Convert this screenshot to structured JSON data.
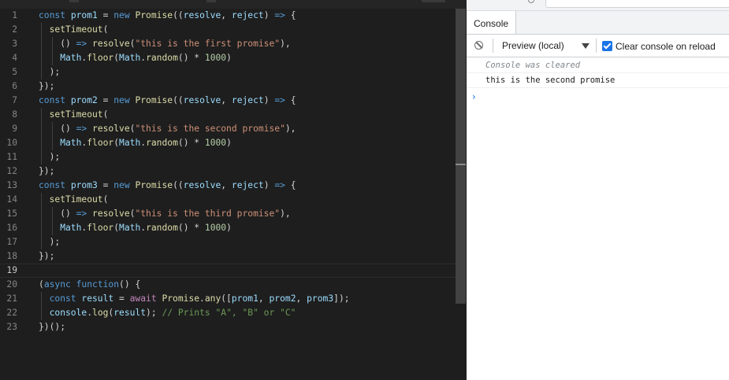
{
  "editor": {
    "lines": [
      {
        "n": "1",
        "indent": 0,
        "tokens": [
          [
            "kw",
            "const "
          ],
          [
            "var",
            "prom1"
          ],
          [
            "pun",
            " = "
          ],
          [
            "kw",
            "new "
          ],
          [
            "fn",
            "Promise"
          ],
          [
            "pun",
            "(("
          ],
          [
            "var",
            "resolve"
          ],
          [
            "pun",
            ", "
          ],
          [
            "var",
            "reject"
          ],
          [
            "pun",
            ") "
          ],
          [
            "kw",
            "=>"
          ],
          [
            "pun",
            " {"
          ]
        ]
      },
      {
        "n": "2",
        "indent": 1,
        "tokens": [
          [
            "fn",
            "setTimeout"
          ],
          [
            "pun",
            "("
          ]
        ]
      },
      {
        "n": "3",
        "indent": 2,
        "tokens": [
          [
            "pun",
            "() "
          ],
          [
            "kw",
            "=>"
          ],
          [
            "pun",
            " "
          ],
          [
            "fn",
            "resolve"
          ],
          [
            "pun",
            "("
          ],
          [
            "str",
            "\"this is the first promise\""
          ],
          [
            "pun",
            "),"
          ]
        ]
      },
      {
        "n": "4",
        "indent": 2,
        "tokens": [
          [
            "var",
            "Math"
          ],
          [
            "pun",
            "."
          ],
          [
            "fn",
            "floor"
          ],
          [
            "pun",
            "("
          ],
          [
            "var",
            "Math"
          ],
          [
            "pun",
            "."
          ],
          [
            "fn",
            "random"
          ],
          [
            "pun",
            "() * "
          ],
          [
            "num",
            "1000"
          ],
          [
            "pun",
            ")"
          ]
        ]
      },
      {
        "n": "5",
        "indent": 1,
        "tokens": [
          [
            "pun",
            ");"
          ]
        ]
      },
      {
        "n": "6",
        "indent": 0,
        "tokens": [
          [
            "pun",
            "});"
          ]
        ]
      },
      {
        "n": "7",
        "indent": 0,
        "tokens": [
          [
            "kw",
            "const "
          ],
          [
            "var",
            "prom2"
          ],
          [
            "pun",
            " = "
          ],
          [
            "kw",
            "new "
          ],
          [
            "fn",
            "Promise"
          ],
          [
            "pun",
            "(("
          ],
          [
            "var",
            "resolve"
          ],
          [
            "pun",
            ", "
          ],
          [
            "var",
            "reject"
          ],
          [
            "pun",
            ") "
          ],
          [
            "kw",
            "=>"
          ],
          [
            "pun",
            " {"
          ]
        ]
      },
      {
        "n": "8",
        "indent": 1,
        "tokens": [
          [
            "fn",
            "setTimeout"
          ],
          [
            "pun",
            "("
          ]
        ]
      },
      {
        "n": "9",
        "indent": 2,
        "tokens": [
          [
            "pun",
            "() "
          ],
          [
            "kw",
            "=>"
          ],
          [
            "pun",
            " "
          ],
          [
            "fn",
            "resolve"
          ],
          [
            "pun",
            "("
          ],
          [
            "str",
            "\"this is the second promise\""
          ],
          [
            "pun",
            "),"
          ]
        ]
      },
      {
        "n": "10",
        "indent": 2,
        "tokens": [
          [
            "var",
            "Math"
          ],
          [
            "pun",
            "."
          ],
          [
            "fn",
            "floor"
          ],
          [
            "pun",
            "("
          ],
          [
            "var",
            "Math"
          ],
          [
            "pun",
            "."
          ],
          [
            "fn",
            "random"
          ],
          [
            "pun",
            "() * "
          ],
          [
            "num",
            "1000"
          ],
          [
            "pun",
            ")"
          ]
        ]
      },
      {
        "n": "11",
        "indent": 1,
        "tokens": [
          [
            "pun",
            ");"
          ]
        ]
      },
      {
        "n": "12",
        "indent": 0,
        "tokens": [
          [
            "pun",
            "});"
          ]
        ]
      },
      {
        "n": "13",
        "indent": 0,
        "tokens": [
          [
            "kw",
            "const "
          ],
          [
            "var",
            "prom3"
          ],
          [
            "pun",
            " = "
          ],
          [
            "kw",
            "new "
          ],
          [
            "fn",
            "Promise"
          ],
          [
            "pun",
            "(("
          ],
          [
            "var",
            "resolve"
          ],
          [
            "pun",
            ", "
          ],
          [
            "var",
            "reject"
          ],
          [
            "pun",
            ") "
          ],
          [
            "kw",
            "=>"
          ],
          [
            "pun",
            " {"
          ]
        ]
      },
      {
        "n": "14",
        "indent": 1,
        "tokens": [
          [
            "fn",
            "setTimeout"
          ],
          [
            "pun",
            "("
          ]
        ]
      },
      {
        "n": "15",
        "indent": 2,
        "tokens": [
          [
            "pun",
            "() "
          ],
          [
            "kw",
            "=>"
          ],
          [
            "pun",
            " "
          ],
          [
            "fn",
            "resolve"
          ],
          [
            "pun",
            "("
          ],
          [
            "str",
            "\"this is the third promise\""
          ],
          [
            "pun",
            "),"
          ]
        ]
      },
      {
        "n": "16",
        "indent": 2,
        "tokens": [
          [
            "var",
            "Math"
          ],
          [
            "pun",
            "."
          ],
          [
            "fn",
            "floor"
          ],
          [
            "pun",
            "("
          ],
          [
            "var",
            "Math"
          ],
          [
            "pun",
            "."
          ],
          [
            "fn",
            "random"
          ],
          [
            "pun",
            "() * "
          ],
          [
            "num",
            "1000"
          ],
          [
            "pun",
            ")"
          ]
        ]
      },
      {
        "n": "17",
        "indent": 1,
        "tokens": [
          [
            "pun",
            ");"
          ]
        ]
      },
      {
        "n": "18",
        "indent": 0,
        "tokens": [
          [
            "pun",
            "});"
          ]
        ]
      },
      {
        "n": "19",
        "indent": 0,
        "tokens": [],
        "current": true
      },
      {
        "n": "20",
        "indent": 0,
        "tokens": [
          [
            "pun",
            "("
          ],
          [
            "kw",
            "async "
          ],
          [
            "kw",
            "function"
          ],
          [
            "pun",
            "() {"
          ]
        ]
      },
      {
        "n": "21",
        "indent": 1,
        "tokens": [
          [
            "kw",
            "const "
          ],
          [
            "var",
            "result"
          ],
          [
            "pun",
            " = "
          ],
          [
            "ctl",
            "await "
          ],
          [
            "fn",
            "Promise"
          ],
          [
            "pun",
            "."
          ],
          [
            "fn",
            "any"
          ],
          [
            "pun",
            "(["
          ],
          [
            "var",
            "prom1"
          ],
          [
            "pun",
            ", "
          ],
          [
            "var",
            "prom2"
          ],
          [
            "pun",
            ", "
          ],
          [
            "var",
            "prom3"
          ],
          [
            "pun",
            "]);"
          ]
        ]
      },
      {
        "n": "22",
        "indent": 1,
        "tokens": [
          [
            "var",
            "console"
          ],
          [
            "pun",
            "."
          ],
          [
            "fn",
            "log"
          ],
          [
            "pun",
            "("
          ],
          [
            "var",
            "result"
          ],
          [
            "pun",
            "); "
          ],
          [
            "cmt",
            "// Prints \"A\", \"B\" or \"C\""
          ]
        ]
      },
      {
        "n": "23",
        "indent": 0,
        "tokens": [
          [
            "pun",
            "})();"
          ]
        ]
      }
    ]
  },
  "devtools": {
    "tab_label": "Console",
    "context_label": "Preview (local)",
    "clear_on_reload_label": "Clear console on reload",
    "clear_on_reload_checked": true,
    "messages": {
      "cleared": "Console was cleared",
      "log": "this is the second promise"
    },
    "prompt_symbol": "›"
  },
  "colors": {
    "editor_bg": "#1e1e1e",
    "keyword": "#569cd6",
    "variable": "#9cdcfe",
    "function": "#dcdcaa",
    "string": "#ce9178",
    "number": "#b5cea8",
    "control": "#c586c0",
    "comment": "#6a9955",
    "accent": "#1a73e8"
  }
}
